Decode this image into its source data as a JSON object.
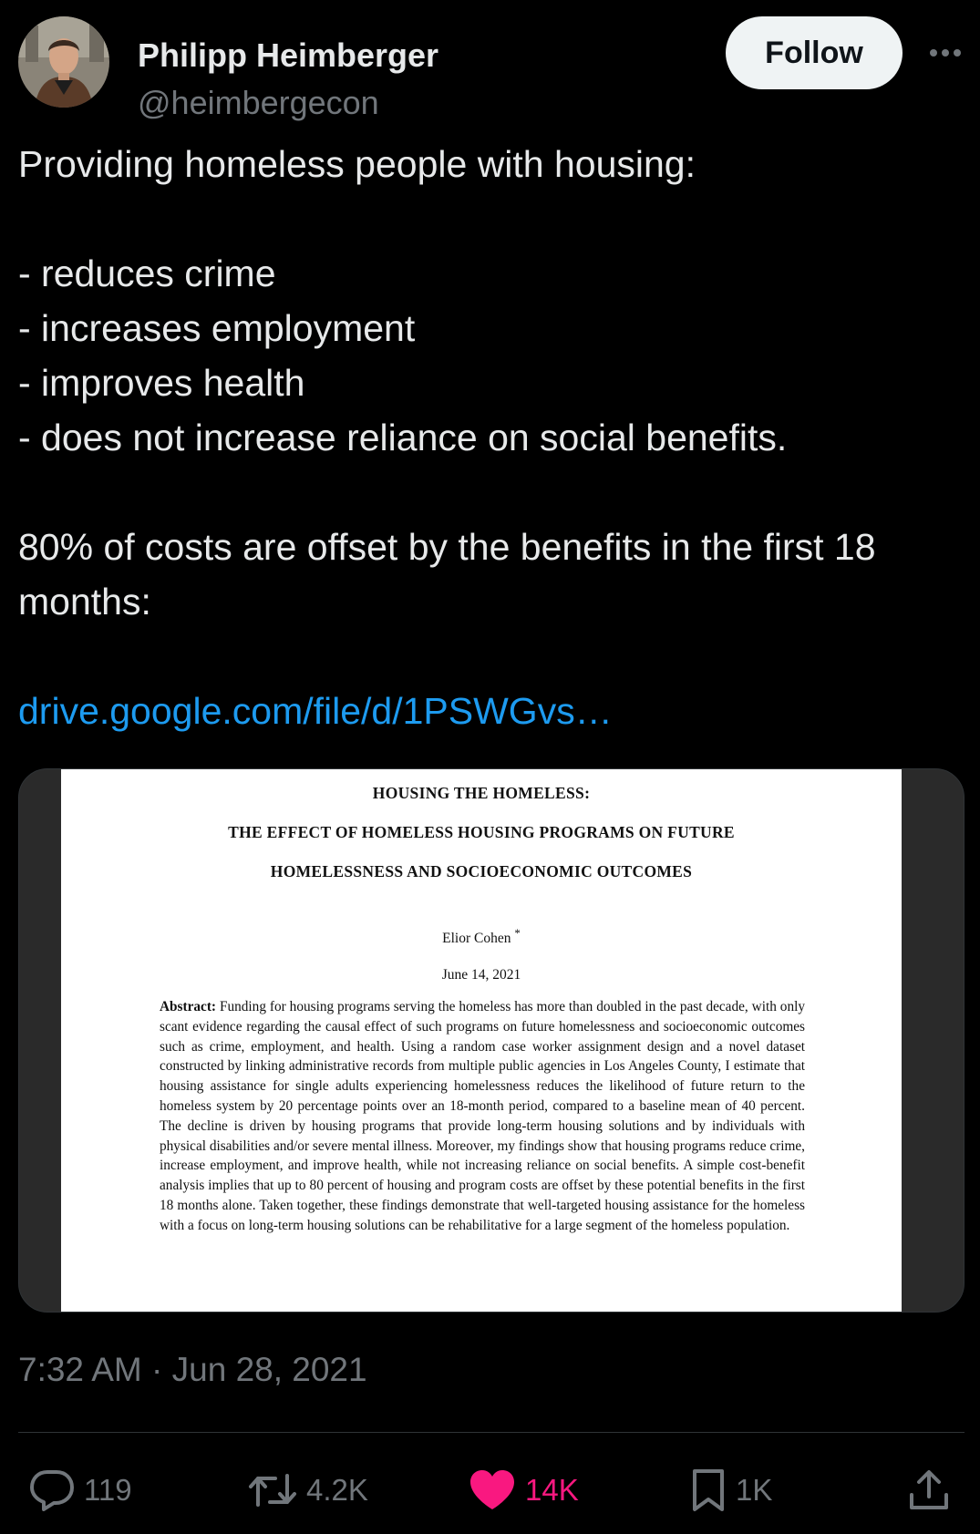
{
  "author": {
    "name": "Philipp Heimberger",
    "handle": "@heimbergecon"
  },
  "follow_label": "Follow",
  "more_icon": "more-horizontal-icon",
  "tweet": {
    "intro": "Providing homeless people with housing:",
    "bullets": [
      "- reduces crime",
      "- increases employment",
      "- improves health",
      "- does not increase reliance on social benefits."
    ],
    "summary": "80% of costs are offset by the benefits in the first 18 months:",
    "link": "drive.google.com/file/d/1PSWGvs…"
  },
  "paper": {
    "title_line1": "HOUSING THE HOMELESS:",
    "title_line2": "THE EFFECT OF HOMELESS HOUSING PROGRAMS ON FUTURE",
    "title_line3": "HOMELESSNESS AND SOCIOECONOMIC OUTCOMES",
    "author": "Elior Cohen",
    "author_mark": "*",
    "date": "June 14, 2021",
    "abstract_label": "Abstract:",
    "abstract_text": "Funding for housing programs serving the homeless has more than doubled in the past decade, with only scant evidence regarding the causal effect of such programs on future homelessness and socioeconomic outcomes such as crime, employment, and health. Using a random case worker assignment design and a novel dataset constructed by linking administrative records from multiple public agencies in Los Angeles County, I estimate that housing assistance for single adults experiencing homelessness reduces the likelihood of future return to the homeless system by 20 percentage points over an 18-month period, compared to a baseline mean of 40 percent. The decline is driven by housing programs that provide long-term housing solutions and by individuals with physical disabilities and/or severe mental illness. Moreover, my findings show that housing programs reduce crime, increase employment, and improve health, while not increasing reliance on social benefits. A simple cost-benefit analysis implies that up to 80 percent of housing and program costs are offset by these potential benefits in the first 18 months alone. Taken together, these findings demonstrate that well-targeted housing assistance for the homeless with a focus on long-term housing solutions can be rehabilitative for a large segment of the homeless population."
  },
  "timestamp": "7:32 AM · Jun 28, 2021",
  "actions": {
    "replies": "119",
    "reposts": "4.2K",
    "likes": "14K",
    "bookmarks": "1K"
  },
  "colors": {
    "background": "#000000",
    "text": "#e7e9ea",
    "muted": "#71767b",
    "link": "#1d9bf0",
    "like": "#f91880"
  }
}
